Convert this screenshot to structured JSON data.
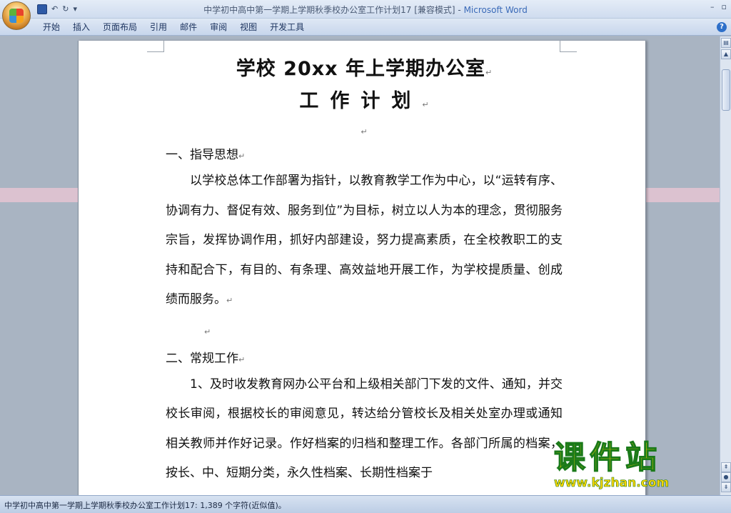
{
  "window": {
    "title": "中学初中高中第一学期上学期秋季校办公室工作计划17 [兼容模式] - ",
    "app_name": "Microsoft Word",
    "minimize": "–",
    "restore": "▫"
  },
  "qat": {
    "undo": "↶",
    "redo": "↻",
    "customize": "▾"
  },
  "ribbon": {
    "tabs": [
      "开始",
      "插入",
      "页面布局",
      "引用",
      "邮件",
      "审阅",
      "视图",
      "开发工具"
    ],
    "help": "?"
  },
  "document": {
    "title_line1": "学校 20xx 年上学期办公室",
    "title_line2": "工作计划",
    "paragraph_mark": "↵",
    "section1_heading": "一、指导思想",
    "section1_body": "以学校总体工作部署为指针，以教育教学工作为中心，以“运转有序、协调有力、督促有效、服务到位”为目标，树立以人为本的理念，贯彻服务宗旨，发挥协调作用，抓好内部建设，努力提高素质，在全校教职工的支持和配合下，有目的、有条理、高效益地开展工作，为学校提质量、创成绩而服务。",
    "section2_heading": "二、常规工作",
    "section2_item1": "1、及时收发教育网办公平台和上级相关部门下发的文件、通知，并交校长审阅，根据校长的审阅意见，转达给分管校长及相关处室办理或通知相关教师并作好记录。作好档案的归档和整理工作。各部门所属的档案，按长、中、短期分类，永久性档案、长期性档案于"
  },
  "statusbar": {
    "text": "中学初中高中第一学期上学期秋季校办公室工作计划17: 1,389 个字符(近似值)。"
  },
  "watermark": {
    "logo_text": "课件站",
    "url": "www.kjzhan.com"
  },
  "colors": {
    "ribbon_bg": "#dfe8f5",
    "workspace_bg": "#a9b4c2",
    "app_name": "#3a6ab8",
    "watermark_fill": "#ffd700",
    "watermark_stroke": "#1a7a1a"
  }
}
